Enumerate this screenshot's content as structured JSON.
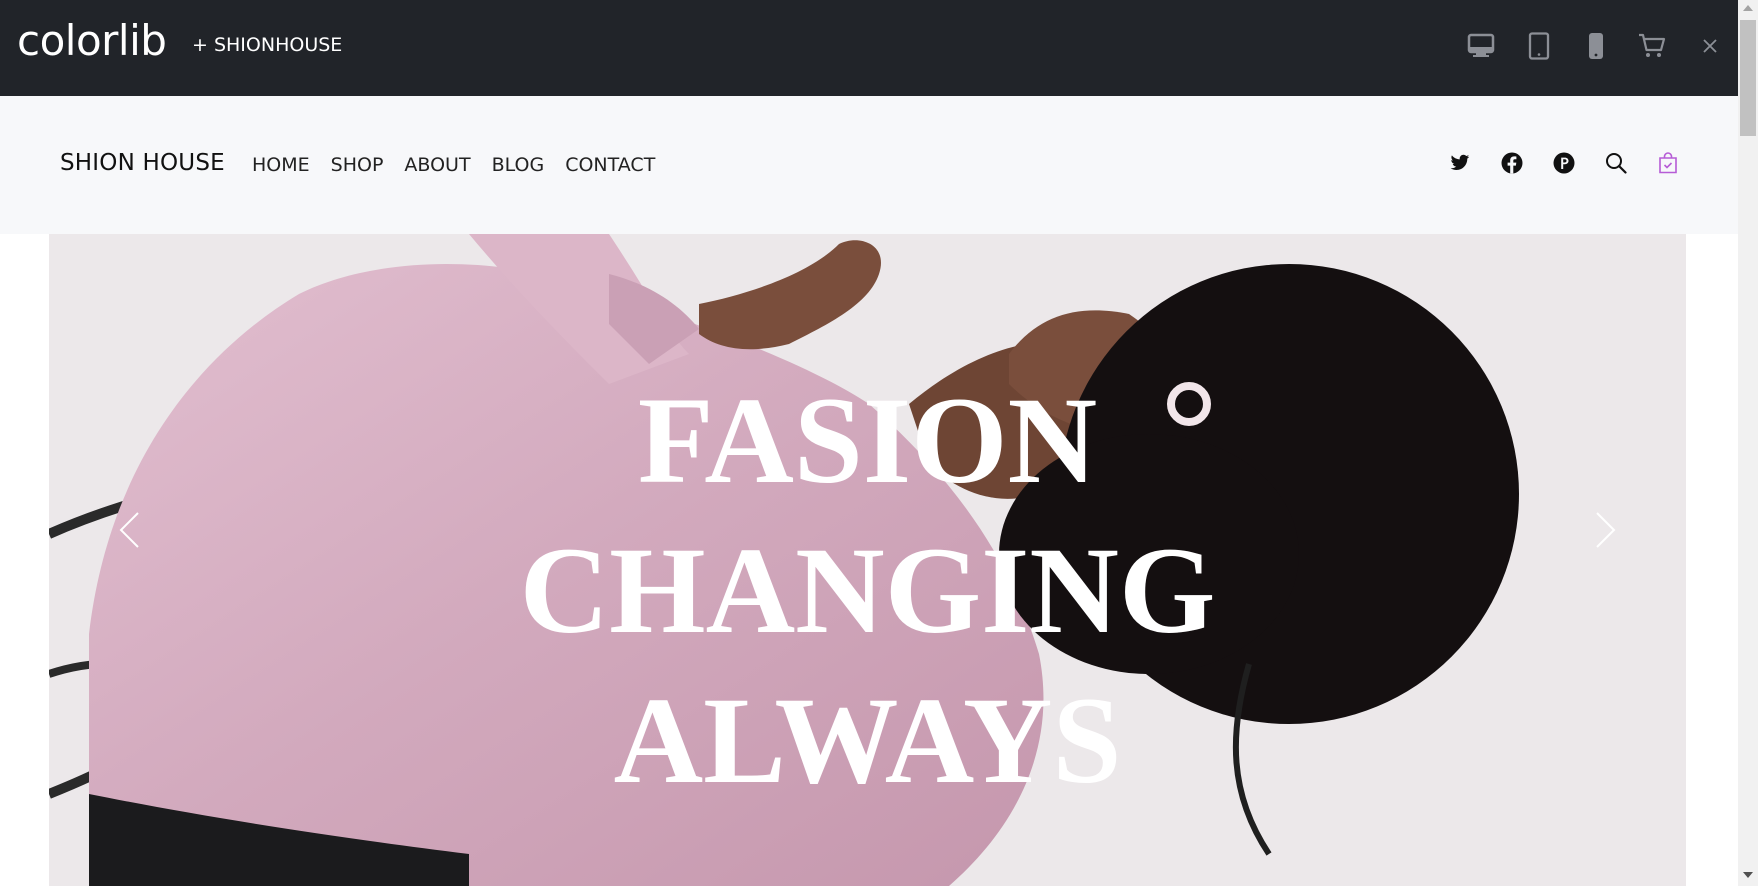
{
  "topbar": {
    "brand": "colorlib",
    "product_link": "+ SHIONHOUSE",
    "devices": [
      {
        "name": "desktop",
        "icon": "desktop-icon"
      },
      {
        "name": "tablet",
        "icon": "tablet-icon"
      },
      {
        "name": "mobile",
        "icon": "mobile-icon"
      },
      {
        "name": "cart",
        "icon": "cart-icon"
      }
    ],
    "close_label": "×"
  },
  "header": {
    "logo": "SHION HOUSE",
    "nav": [
      "HOME",
      "SHOP",
      "ABOUT",
      "BLOG",
      "CONTACT"
    ],
    "icons": [
      "twitter-icon",
      "facebook-icon",
      "pinterest-icon",
      "search-icon",
      "shopping-bag-icon"
    ],
    "accent_color": "#b65cd6"
  },
  "hero": {
    "title_lines": [
      "FASION",
      "CHANGING",
      "ALWAYS"
    ],
    "image_description_colors": {
      "background": "#ece8ea",
      "shirt": "#d7b0c2",
      "hair": "#140f10",
      "skin": "#7a4e3c"
    }
  },
  "colors": {
    "topbar": "#212429",
    "header_bg": "#f7f8fa",
    "text_dark": "#222222"
  }
}
